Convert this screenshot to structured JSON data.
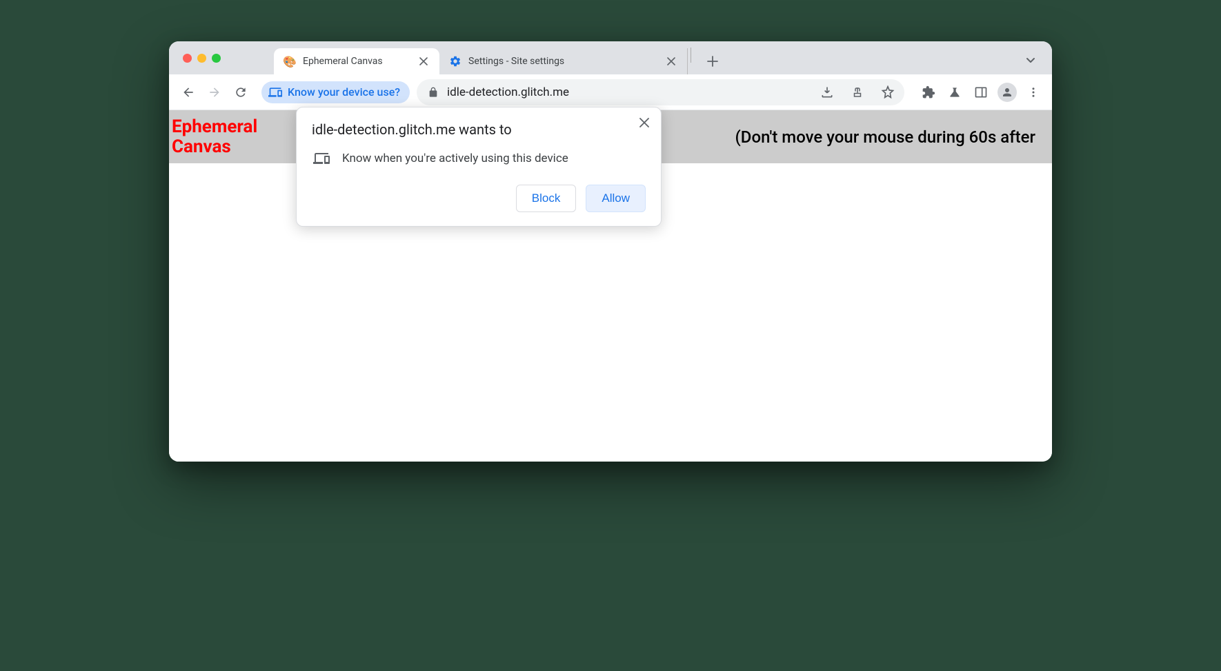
{
  "tabs": [
    {
      "title": "Ephemeral Canvas",
      "active": true
    },
    {
      "title": "Settings - Site settings",
      "active": false
    }
  ],
  "toolbar": {
    "permission_chip": "Know your device use?",
    "url": "idle-detection.glitch.me"
  },
  "page": {
    "title": "Ephemeral Canvas",
    "instruction": "(Don't move your mouse during 60s after"
  },
  "dialog": {
    "title": "idle-detection.glitch.me wants to",
    "permission_text": "Know when you're actively using this device",
    "block_label": "Block",
    "allow_label": "Allow"
  }
}
